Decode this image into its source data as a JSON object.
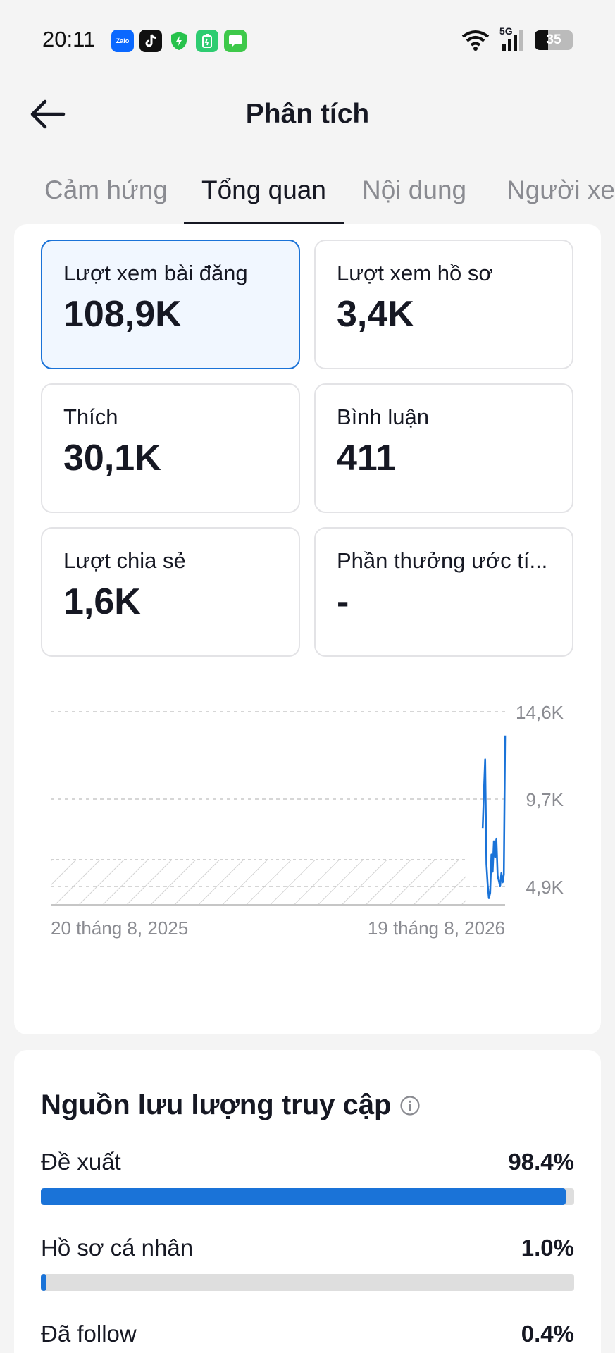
{
  "status_bar": {
    "time": "20:11",
    "apps": [
      "Zalo",
      "tiktok-icon",
      "shield-icon",
      "battery-saver-icon",
      "messages-icon"
    ],
    "zalo_label": "Zalo",
    "network": "5G",
    "battery": "35"
  },
  "header": {
    "title": "Phân tích"
  },
  "tabs": [
    {
      "label": "Cảm hứng",
      "active": false
    },
    {
      "label": "Tổng quan",
      "active": true
    },
    {
      "label": "Nội dung",
      "active": false
    },
    {
      "label": "Người xem",
      "active": false
    }
  ],
  "stats": [
    {
      "label": "Lượt xem bài đăng",
      "value": "108,9K",
      "selected": true
    },
    {
      "label": "Lượt xem hồ sơ",
      "value": "3,4K",
      "selected": false
    },
    {
      "label": "Thích",
      "value": "30,1K",
      "selected": false
    },
    {
      "label": "Bình luận",
      "value": "411",
      "selected": false
    },
    {
      "label": "Lượt chia sẻ",
      "value": "1,6K",
      "selected": false
    },
    {
      "label": "Phần thưởng ước tí...",
      "value": "-",
      "selected": false
    }
  ],
  "chart_data": {
    "type": "line",
    "x_start_label": "20 tháng 8, 2025",
    "x_end_label": "19 tháng 8, 2026",
    "y_ticks": [
      "14,6K",
      "9,7K",
      "4,9K"
    ],
    "ylim": [
      0,
      14600
    ],
    "line_color": "#1a73d8",
    "series": [
      {
        "x_day_index": [
          347,
          348,
          349,
          350,
          351,
          352,
          353,
          354,
          355,
          356,
          357,
          358,
          359,
          360,
          361,
          362,
          363,
          364,
          365
        ],
        "values": [
          5800,
          8600,
          11000,
          3100,
          1500,
          500,
          900,
          3800,
          2500,
          4800,
          3600,
          5000,
          2200,
          1800,
          1400,
          2400,
          1700,
          2300,
          12800
        ]
      }
    ],
    "shaded_region_note": "hatched area",
    "grid": true
  },
  "traffic": {
    "title": "Nguồn lưu lượng truy cập",
    "rows": [
      {
        "name": "Đề xuất",
        "percent": "98.4%",
        "fill": 0.984
      },
      {
        "name": "Hồ sơ cá nhân",
        "percent": "1.0%",
        "fill": 0.01
      },
      {
        "name": "Đã follow",
        "percent": "0.4%",
        "fill": 0.004
      }
    ]
  },
  "colors": {
    "accent": "#1a73d8",
    "selected_bg": "#f1f7ff",
    "text": "#161823",
    "muted": "#8a8b91"
  }
}
